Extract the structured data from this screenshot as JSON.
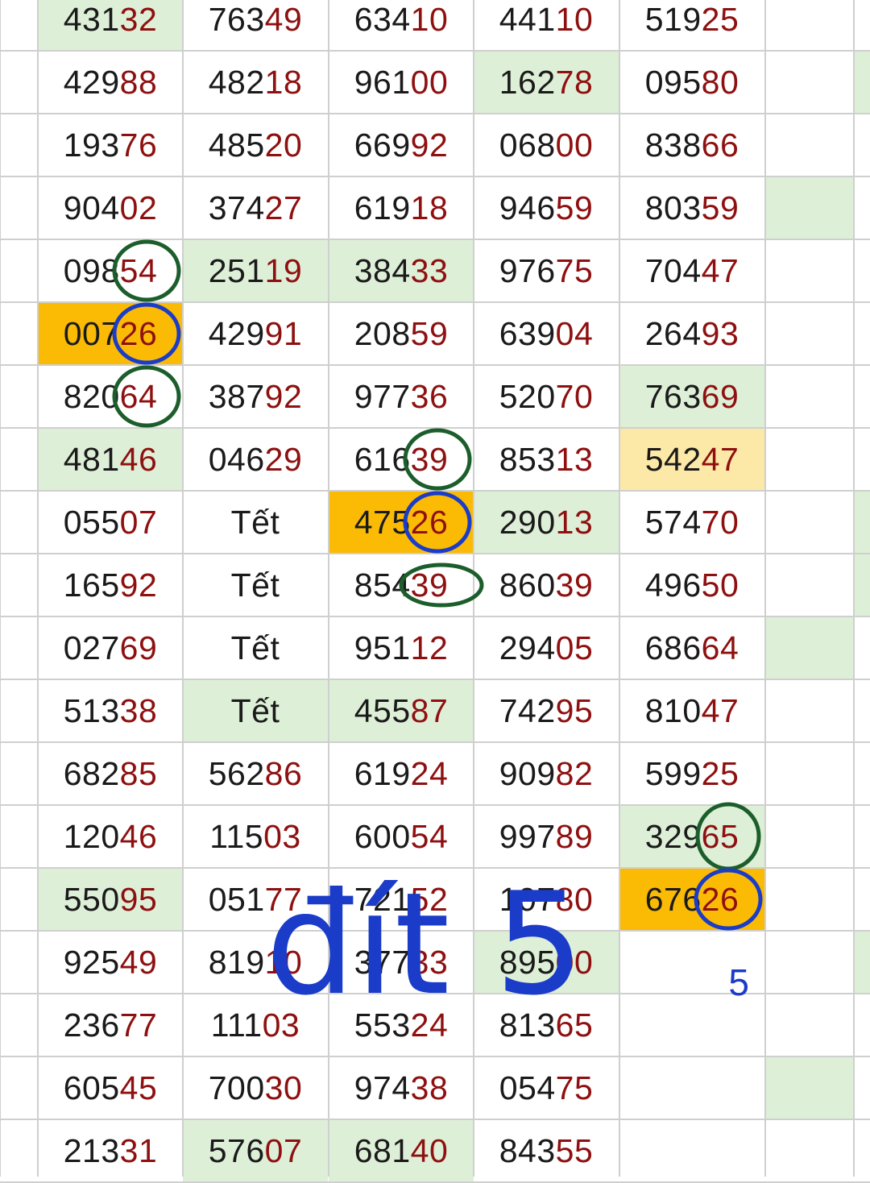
{
  "sheet": {
    "colors": {
      "highlight_green": "#deefd8",
      "highlight_orange": "#fbbb04",
      "highlight_lightyellow": "#fde9a7",
      "prefix_text": "#1a1a1a",
      "suffix_text": "#8e1010",
      "annotation_blue": "#1a3cc8",
      "circle_green": "#1c5e2b",
      "circle_blue": "#1a3cc8"
    },
    "rows": [
      [
        {
          "p": "431",
          "s": "32",
          "bg": "green"
        },
        {
          "p": "763",
          "s": "49"
        },
        {
          "p": "634",
          "s": "10"
        },
        {
          "p": "441",
          "s": "10"
        },
        {
          "p": "519",
          "s": "25"
        },
        {
          "t": ""
        }
      ],
      [
        {
          "p": "429",
          "s": "88"
        },
        {
          "p": "482",
          "s": "18"
        },
        {
          "p": "961",
          "s": "00"
        },
        {
          "p": "162",
          "s": "78",
          "bg": "green"
        },
        {
          "p": "095",
          "s": "80"
        },
        {
          "t": ""
        }
      ],
      [
        {
          "p": "193",
          "s": "76"
        },
        {
          "p": "485",
          "s": "20"
        },
        {
          "p": "669",
          "s": "92"
        },
        {
          "p": "068",
          "s": "00"
        },
        {
          "p": "838",
          "s": "66"
        },
        {
          "t": ""
        }
      ],
      [
        {
          "p": "904",
          "s": "02"
        },
        {
          "p": "374",
          "s": "27"
        },
        {
          "p": "619",
          "s": "18"
        },
        {
          "p": "946",
          "s": "59"
        },
        {
          "p": "803",
          "s": "59"
        },
        {
          "t": "",
          "bg": "green"
        }
      ],
      [
        {
          "p": "098",
          "s": "54"
        },
        {
          "p": "251",
          "s": "19",
          "bg": "green"
        },
        {
          "p": "384",
          "s": "33",
          "bg": "green"
        },
        {
          "p": "976",
          "s": "75"
        },
        {
          "p": "704",
          "s": "47"
        },
        {
          "t": ""
        }
      ],
      [
        {
          "p": "007",
          "s": "26",
          "bg": "orange"
        },
        {
          "p": "429",
          "s": "91"
        },
        {
          "p": "208",
          "s": "59"
        },
        {
          "p": "639",
          "s": "04"
        },
        {
          "p": "264",
          "s": "93"
        },
        {
          "t": ""
        }
      ],
      [
        {
          "p": "820",
          "s": "64"
        },
        {
          "p": "387",
          "s": "92"
        },
        {
          "p": "977",
          "s": "36"
        },
        {
          "p": "520",
          "s": "70"
        },
        {
          "p": "763",
          "s": "69",
          "bg": "green"
        },
        {
          "t": ""
        }
      ],
      [
        {
          "p": "481",
          "s": "46",
          "bg": "green"
        },
        {
          "p": "046",
          "s": "29"
        },
        {
          "p": "616",
          "s": "39"
        },
        {
          "p": "853",
          "s": "13"
        },
        {
          "p": "542",
          "s": "47",
          "bg": "lightyellow"
        },
        {
          "t": ""
        }
      ],
      [
        {
          "p": "055",
          "s": "07"
        },
        {
          "t": "Tết"
        },
        {
          "p": "475",
          "s": "26",
          "bg": "orange"
        },
        {
          "p": "290",
          "s": "13",
          "bg": "green"
        },
        {
          "p": "574",
          "s": "70"
        },
        {
          "t": ""
        }
      ],
      [
        {
          "p": "165",
          "s": "92"
        },
        {
          "t": "Tết"
        },
        {
          "p": "854",
          "s": "39"
        },
        {
          "p": "860",
          "s": "39"
        },
        {
          "p": "496",
          "s": "50"
        },
        {
          "t": ""
        }
      ],
      [
        {
          "p": "027",
          "s": "69"
        },
        {
          "t": "Tết"
        },
        {
          "p": "951",
          "s": "12"
        },
        {
          "p": "294",
          "s": "05"
        },
        {
          "p": "686",
          "s": "64"
        },
        {
          "t": "",
          "bg": "green"
        }
      ],
      [
        {
          "p": "513",
          "s": "38"
        },
        {
          "t": "Tết",
          "bg": "green"
        },
        {
          "p": "455",
          "s": "87",
          "bg": "green"
        },
        {
          "p": "742",
          "s": "95"
        },
        {
          "p": "810",
          "s": "47"
        },
        {
          "t": ""
        }
      ],
      [
        {
          "p": "682",
          "s": "85"
        },
        {
          "p": "562",
          "s": "86"
        },
        {
          "p": "619",
          "s": "24"
        },
        {
          "p": "909",
          "s": "82"
        },
        {
          "p": "599",
          "s": "25"
        },
        {
          "t": ""
        }
      ],
      [
        {
          "p": "120",
          "s": "46"
        },
        {
          "p": "115",
          "s": "03"
        },
        {
          "p": "600",
          "s": "54"
        },
        {
          "p": "997",
          "s": "89"
        },
        {
          "p": "329",
          "s": "65",
          "bg": "green"
        },
        {
          "t": ""
        }
      ],
      [
        {
          "p": "550",
          "s": "95",
          "bg": "green"
        },
        {
          "p": "051",
          "s": "77"
        },
        {
          "p": "721",
          "s": "52"
        },
        {
          "p": "107",
          "s": "80"
        },
        {
          "p": "676",
          "s": "26",
          "bg": "orange"
        },
        {
          "t": ""
        }
      ],
      [
        {
          "p": "925",
          "s": "49"
        },
        {
          "p": "819",
          "s": "10"
        },
        {
          "p": "377",
          "s": "33"
        },
        {
          "p": "895",
          "s": "00",
          "bg": "green"
        },
        {
          "t": ""
        },
        {
          "t": ""
        }
      ],
      [
        {
          "p": "236",
          "s": "77"
        },
        {
          "p": "111",
          "s": "03"
        },
        {
          "p": "553",
          "s": "24"
        },
        {
          "p": "813",
          "s": "65"
        },
        {
          "t": ""
        },
        {
          "t": ""
        }
      ],
      [
        {
          "p": "605",
          "s": "45"
        },
        {
          "p": "700",
          "s": "30"
        },
        {
          "p": "974",
          "s": "38"
        },
        {
          "p": "054",
          "s": "75"
        },
        {
          "t": ""
        },
        {
          "t": "",
          "bg": "green"
        }
      ],
      [
        {
          "p": "213",
          "s": "31"
        },
        {
          "p": "576",
          "s": "07",
          "bg": "green"
        },
        {
          "p": "681",
          "s": "40",
          "bg": "green"
        },
        {
          "p": "843",
          "s": "55"
        },
        {
          "t": ""
        },
        {
          "t": ""
        }
      ]
    ]
  },
  "annotation": {
    "text": "đít 5",
    "count": "5"
  },
  "marks": [
    {
      "type": "green-circle",
      "row": 4,
      "col": 0,
      "target": "54"
    },
    {
      "type": "blue-circle",
      "row": 5,
      "col": 0,
      "target": "26"
    },
    {
      "type": "green-circle",
      "row": 6,
      "col": 0,
      "target": "64"
    },
    {
      "type": "green-circle",
      "row": 7,
      "col": 2,
      "target": "39"
    },
    {
      "type": "blue-circle",
      "row": 8,
      "col": 2,
      "target": "26"
    },
    {
      "type": "green-circle",
      "row": 9,
      "col": 2,
      "target": "39"
    },
    {
      "type": "green-circle",
      "row": 13,
      "col": 4,
      "target": "65"
    },
    {
      "type": "blue-circle",
      "row": 14,
      "col": 4,
      "target": "26"
    }
  ]
}
